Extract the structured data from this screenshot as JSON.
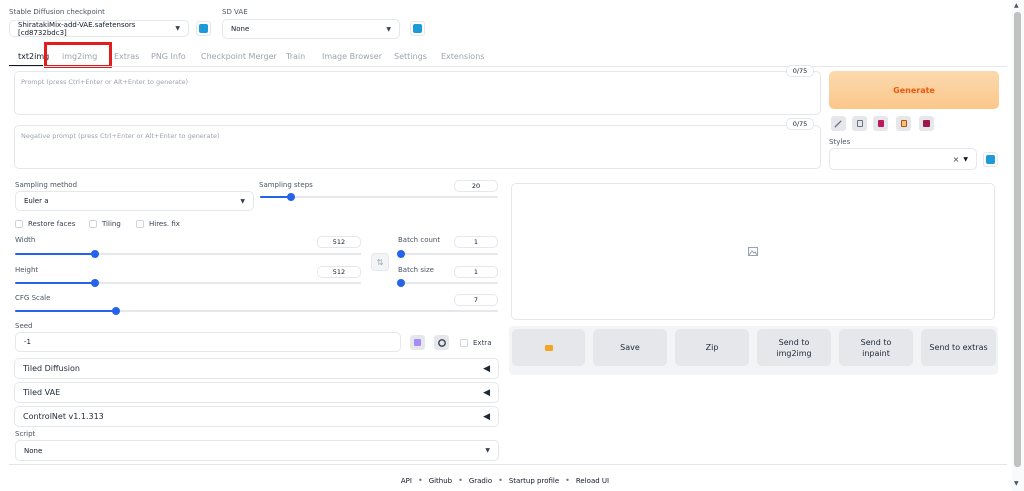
{
  "checkpoint": {
    "label": "Stable Diffusion checkpoint",
    "value": "ShiratakiMix-add-VAE.safetensors [cd8732bdc3]"
  },
  "vae": {
    "label": "SD VAE",
    "value": "None"
  },
  "tabs": [
    "txt2img",
    "img2img",
    "Extras",
    "PNG Info",
    "Checkpoint Merger",
    "Train",
    "Image Browser",
    "Settings",
    "Extensions"
  ],
  "prompt": {
    "placeholder": "Prompt (press Ctrl+Enter or Alt+Enter to generate)",
    "counter": "0/75"
  },
  "negative_prompt": {
    "placeholder": "Negative prompt (press Ctrl+Enter or Alt+Enter to generate)",
    "counter": "0/75"
  },
  "generate_label": "Generate",
  "styles": {
    "label": "Styles",
    "clear": "×"
  },
  "sampling_method": {
    "label": "Sampling method",
    "value": "Euler a"
  },
  "sampling_steps": {
    "label": "Sampling steps",
    "value": "20",
    "fraction": 0.13
  },
  "checkboxes": {
    "restore_faces": "Restore faces",
    "tiling": "Tiling",
    "hires_fix": "Hires. fix"
  },
  "width": {
    "label": "Width",
    "value": "512",
    "fraction": 0.23
  },
  "height": {
    "label": "Height",
    "value": "512",
    "fraction": 0.23
  },
  "batch_count": {
    "label": "Batch count",
    "value": "1",
    "fraction": 0.02
  },
  "batch_size": {
    "label": "Batch size",
    "value": "1",
    "fraction": 0.02
  },
  "cfg_scale": {
    "label": "CFG Scale",
    "value": "7",
    "fraction": 0.21
  },
  "seed": {
    "label": "Seed",
    "value": "-1",
    "extra": "Extra"
  },
  "accordions": {
    "tiled_diffusion": "Tiled Diffusion",
    "tiled_vae": "Tiled VAE",
    "controlnet": "ControlNet v1.1.313"
  },
  "script": {
    "label": "Script",
    "value": "None"
  },
  "output_buttons": {
    "save": "Save",
    "zip": "Zip",
    "send_img2img": "Send to img2img",
    "send_inpaint": "Send to inpaint",
    "send_extras": "Send to extras"
  },
  "footer": {
    "api": "API",
    "github": "Github",
    "gradio": "Gradio",
    "startup": "Startup profile",
    "reload": "Reload UI"
  }
}
